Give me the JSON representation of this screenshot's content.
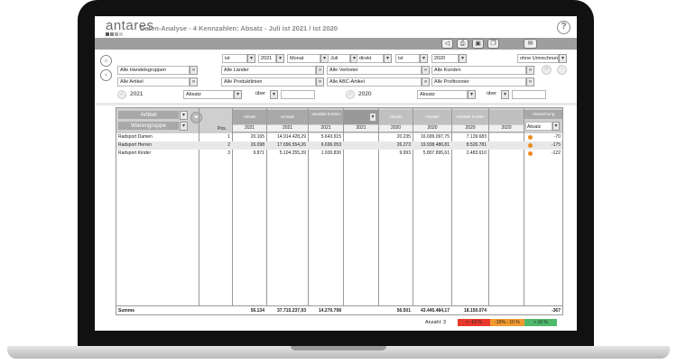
{
  "app": {
    "logo": "antares",
    "title": "Daten-Analyse - 4 Kennzahlen: Absatz - Juli  ist 2021 / ist 2020",
    "help_label": "?"
  },
  "toolbar": {
    "icons": [
      "speaker-icon",
      "print-icon",
      "excel-icon",
      "copy-icon",
      "mail-icon"
    ],
    "glyphs": [
      "◁",
      "⎙",
      "▣",
      "❐",
      "✉"
    ]
  },
  "filters": {
    "row1": {
      "type1": "ist",
      "year1": "2021",
      "period1": "Monat",
      "month": "Juli",
      "mode": "direkt",
      "type2": "ist",
      "year2": "2020",
      "conversion": "ohne Umrechnung"
    },
    "row2": [
      "Alle Handelsgruppen",
      "Alle Länder",
      "Alle Vertreter",
      "Alle Kunden"
    ],
    "row3": [
      "Alle Artikel",
      "Alle Produktlinien",
      "Alle ABC-Artikel",
      "Alle Profitcenter"
    ],
    "row4": {
      "year_a": "2021",
      "measure_a": "Absatz",
      "op_a": "über",
      "year_b": "2020",
      "measure_b": "Absatz",
      "op_b": "über"
    }
  },
  "grid": {
    "dim1": "Artikel",
    "dim2": "Warengruppe",
    "pos_label": "Pos.",
    "col_headers_2021": [
      "Absatz",
      "Umsatz",
      "Variable Kosten",
      ""
    ],
    "col_headers_2020": [
      "Absatz",
      "Umsatz",
      "Variable Kosten",
      ""
    ],
    "deviation_header": "Abweichung",
    "deviation_measure": "Absatz",
    "year_2021": "2021",
    "year_2020": "2020",
    "rows": [
      {
        "name": "Radsport Damen",
        "pos": "1",
        "a21": "20.165",
        "u21": "14.914.428,29",
        "v21": "5.643.915",
        "a20": "20.235",
        "u20": "16.699.097,75",
        "v20": "7.139.683",
        "dev": "-70"
      },
      {
        "name": "Radsport Herren",
        "pos": "2",
        "a21": "26.098",
        "u21": "17.696.554,26",
        "v21": "6.696.053",
        "a20": "26.273",
        "u20": "19.938.486,81",
        "v20": "8.526.781",
        "dev": "-175"
      },
      {
        "name": "Radsport Kinder",
        "pos": "3",
        "a21": "9.871",
        "u21": "5.104.255,39",
        "v21": "1.930.830",
        "a20": "9.993",
        "u20": "5.807.895,61",
        "v20": "2.483.610",
        "dev": "-122"
      }
    ],
    "sum": {
      "label": "Summe",
      "a21": "56.134",
      "u21": "37.715.237,93",
      "v21": "14.270.798",
      "a20": "56.501",
      "u20": "43.445.484,17",
      "v20": "18.150.074",
      "dev": "-367"
    }
  },
  "footer": {
    "count_label": "Anzahl: 3",
    "legend": [
      {
        "label": "< -10 %",
        "color": "#e8382b"
      },
      {
        "label": "-10% - 10 %",
        "color": "#f29a2e"
      },
      {
        "label": "> 10 %",
        "color": "#4fb86a"
      }
    ]
  }
}
